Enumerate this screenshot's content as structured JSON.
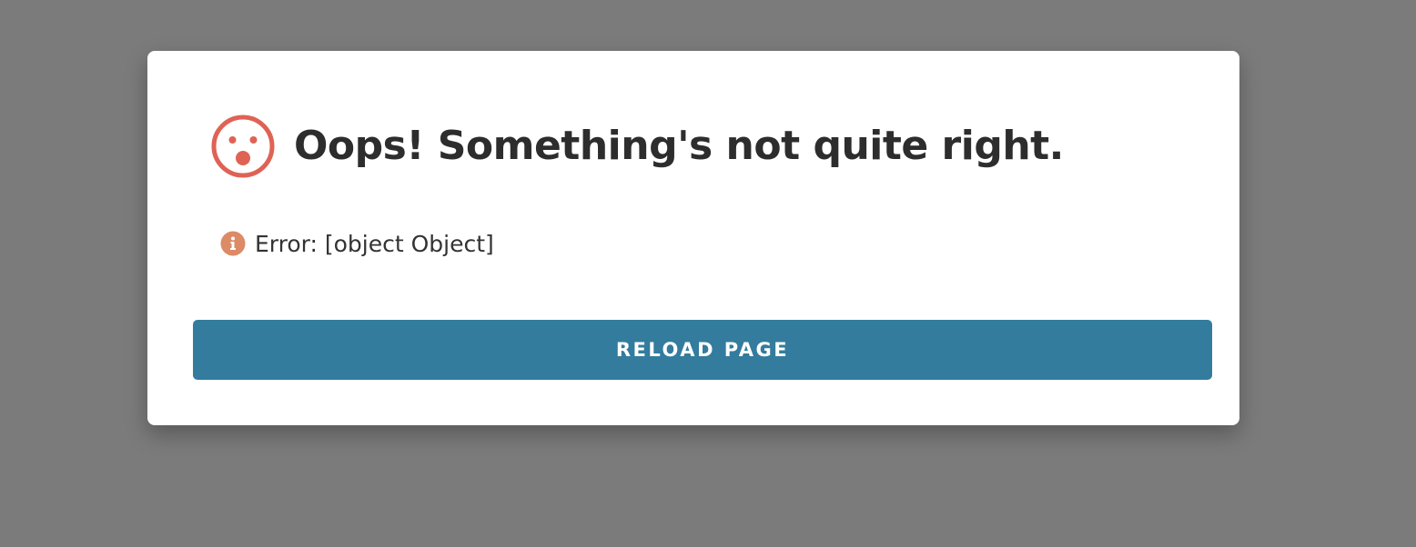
{
  "dialog": {
    "title": "Oops! Something's not quite right.",
    "error_message": "Error: [object Object]",
    "reload_button_label": "RELOAD PAGE",
    "icons": {
      "title_icon": "surprised-face-icon",
      "message_icon": "info-icon"
    }
  },
  "colors": {
    "backdrop": "#7b7b7b",
    "dialog_background": "#ffffff",
    "title_text": "#2d2d2d",
    "face_icon": "#df6355",
    "info_icon": "#db8b66",
    "button_background": "#337c9e",
    "button_text": "#ffffff"
  }
}
